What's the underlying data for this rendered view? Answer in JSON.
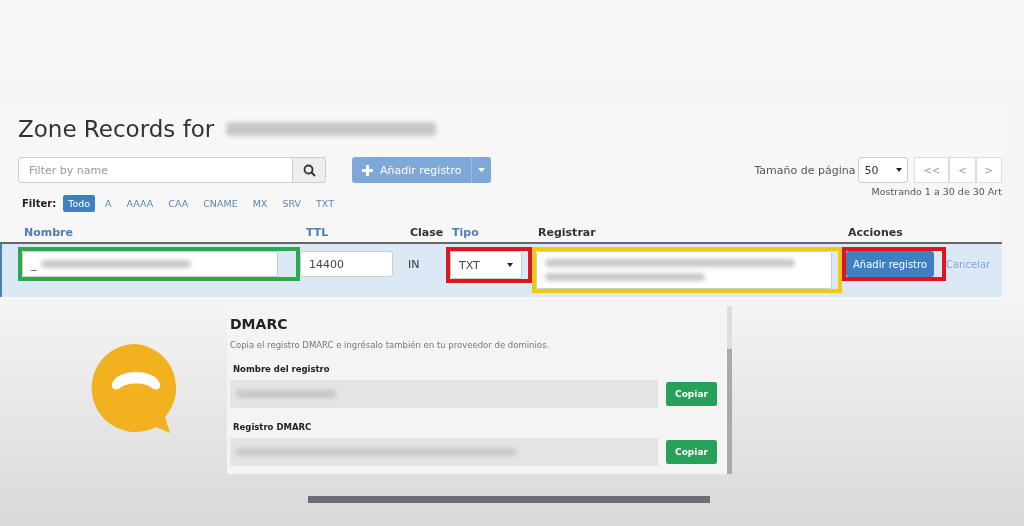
{
  "title": "Zone Records for",
  "filter_field": {
    "placeholder": "Filter by name"
  },
  "add_button": {
    "label": "Añadir registro"
  },
  "page_size": {
    "label": "Tamaño de página",
    "value": "50"
  },
  "pager": [
    "<<",
    "<",
    ">"
  ],
  "showing": "Mostrando 1 a 30 de 30 Art",
  "filter": {
    "label": "Filter:",
    "types": [
      {
        "label": "Todo",
        "selected": true
      },
      {
        "label": "A",
        "selected": false
      },
      {
        "label": "AAAA",
        "selected": false
      },
      {
        "label": "CAA",
        "selected": false
      },
      {
        "label": "CNAME",
        "selected": false
      },
      {
        "label": "MX",
        "selected": false
      },
      {
        "label": "SRV",
        "selected": false
      },
      {
        "label": "TXT",
        "selected": false
      }
    ]
  },
  "columns": [
    {
      "label": "Nombre",
      "sortable": true
    },
    {
      "label": "TTL",
      "sortable": true
    },
    {
      "label": "Clase",
      "sortable": false
    },
    {
      "label": "Tipo",
      "sortable": true
    },
    {
      "label": "Registrar",
      "sortable": false
    },
    {
      "label": "Acciones",
      "sortable": false
    }
  ],
  "edit_row": {
    "name": {
      "value": "_",
      "color": "#2ea84f"
    },
    "ttl": {
      "value": "14400"
    },
    "class": "IN",
    "type": {
      "value": "TXT",
      "color": "#e0141e"
    },
    "record": {
      "color": "#f2c811"
    },
    "submit": {
      "label": "Añadir registro",
      "color": "#e0141e"
    },
    "cancel": "Cancelar"
  },
  "dmarc": {
    "title": "DMARC",
    "description": "Copia el registro DMARC e ingrésalo también en tu proveedor de dominios.",
    "fields": [
      {
        "label": "Nombre del registro",
        "button": "Copiar"
      },
      {
        "label": "Registro DMARC",
        "button": "Copiar"
      }
    ]
  }
}
